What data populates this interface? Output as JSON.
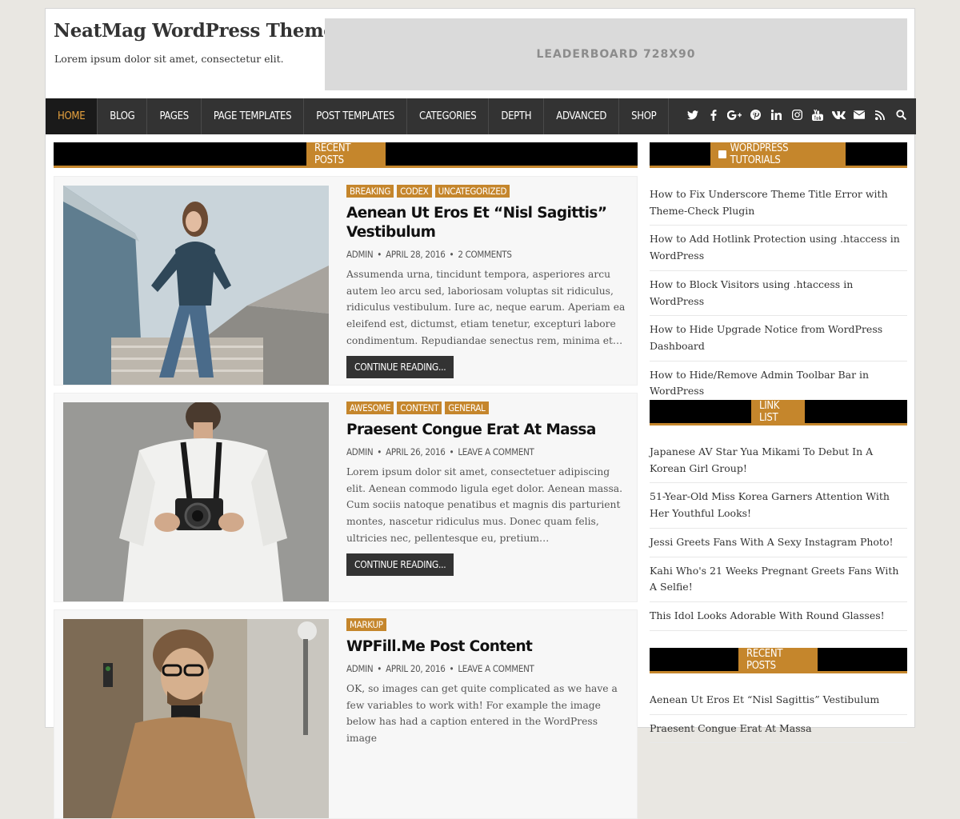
{
  "site": {
    "title": "NeatMag WordPress Theme",
    "description": "Lorem ipsum dolor sit amet, consectetur elit."
  },
  "ad": {
    "label": "LEADERBOARD 728X90"
  },
  "nav": {
    "items": [
      "HOME",
      "BLOG",
      "PAGES",
      "PAGE TEMPLATES",
      "POST TEMPLATES",
      "CATEGORIES",
      "DEPTH",
      "ADVANCED",
      "SHOP"
    ],
    "active": "HOME",
    "social_icons": [
      "twitter-icon",
      "facebook-icon",
      "google-plus-icon",
      "pinterest-icon",
      "linkedin-icon",
      "instagram-icon",
      "youtube-icon",
      "vk-icon",
      "email-icon",
      "rss-icon",
      "search-icon"
    ]
  },
  "main": {
    "section_title": "RECENT POSTS",
    "posts": [
      {
        "categories": [
          "BREAKING",
          "CODEX",
          "UNCATEGORIZED"
        ],
        "title": "Aenean Ut Eros Et “Nisl Sagittis” Vestibulum",
        "author": "ADMIN",
        "date": "APRIL 28, 2016",
        "comments": "2 COMMENTS",
        "excerpt": "Assumenda urna, tincidunt tempora, asperiores arcu autem leo arcu sed, laboriosam voluptas sit ridiculus, ridiculus vestibulum. Iure ac, neque earum. Aperiam ea eleifend est, dictumst, etiam tenetur, excepturi labore condimentum. Repudiandae senectus rem, minima et…",
        "more": "CONTINUE READING..."
      },
      {
        "categories": [
          "AWESOME",
          "CONTENT",
          "GENERAL"
        ],
        "title": "Praesent Congue Erat At Massa",
        "author": "ADMIN",
        "date": "APRIL 26, 2016",
        "comments": "LEAVE A COMMENT",
        "excerpt": "Lorem ipsum dolor sit amet, consectetuer adipiscing elit. Aenean commodo ligula eget dolor. Aenean massa. Cum sociis natoque penatibus et magnis dis parturient montes, nascetur ridiculus mus. Donec quam felis, ultricies nec, pellentesque eu, pretium…",
        "more": "CONTINUE READING..."
      },
      {
        "categories": [
          "MARKUP"
        ],
        "title": "WPFill.Me Post Content",
        "author": "ADMIN",
        "date": "APRIL 20, 2016",
        "comments": "LEAVE A COMMENT",
        "excerpt": "OK, so images can get quite complicated as we have a few variables to work with! For example the image below has had a caption entered in the WordPress image",
        "more": ""
      }
    ]
  },
  "sidebar": {
    "widgets": [
      {
        "title": "WORDPRESS TUTORIALS",
        "links": [
          "How to Fix Underscore Theme Title Error with Theme-Check Plugin",
          "How to Add Hotlink Protection using .htaccess in WordPress",
          "How to Block Visitors using .htaccess in WordPress",
          "How to Hide Upgrade Notice from WordPress Dashboard",
          "How to Hide/Remove Admin Toolbar Bar in WordPress"
        ]
      },
      {
        "title": "LINK LIST",
        "links": [
          "Japanese AV Star Yua Mikami To Debut In A Korean Girl Group!",
          "51-Year-Old Miss Korea Garners Attention With Her Youthful Looks!",
          "Jessi Greets Fans With A Sexy Instagram Photo!",
          "Kahi Who's 21 Weeks Pregnant Greets Fans With A Selfie!",
          "This Idol Looks Adorable With Round Glasses!"
        ]
      },
      {
        "title": "RECENT POSTS",
        "links": [
          "Aenean Ut Eros Et “Nisl Sagittis” Vestibulum",
          "Praesent Congue Erat At Massa"
        ]
      }
    ]
  },
  "colors": {
    "accent": "#c5862c",
    "nav_bg": "#333333",
    "nav_active": "#e8a23e"
  }
}
